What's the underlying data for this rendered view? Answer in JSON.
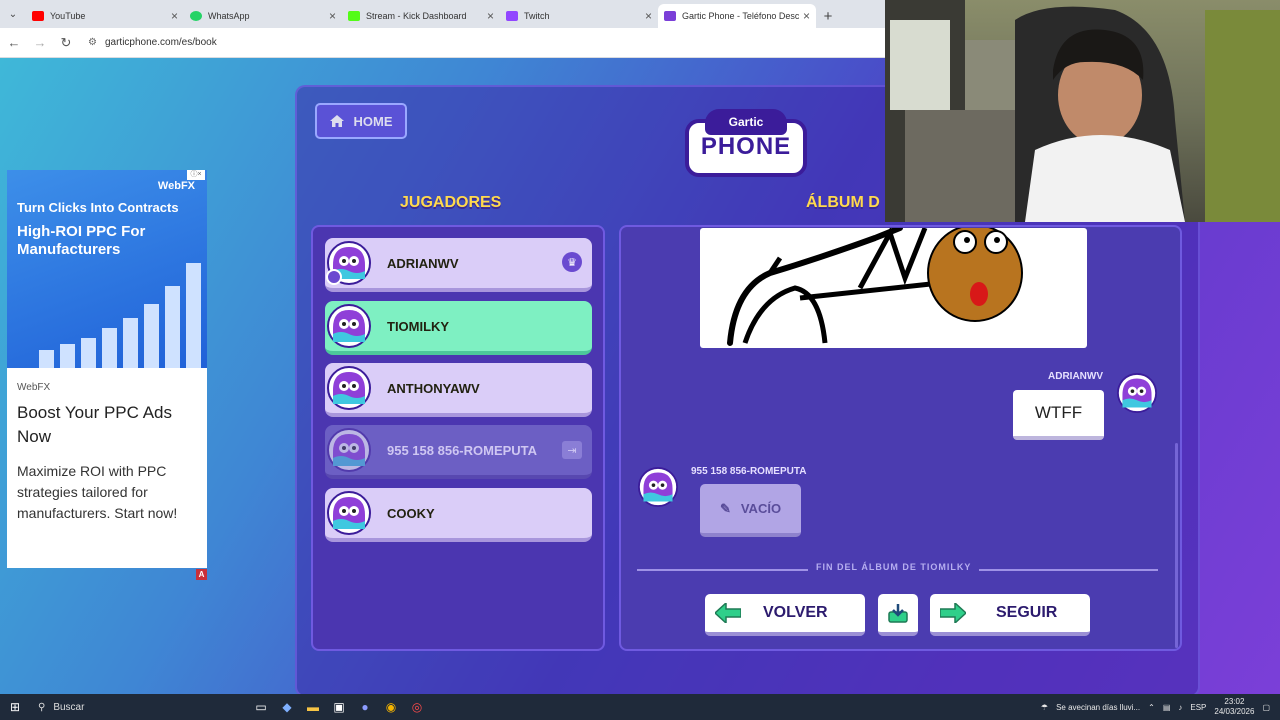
{
  "browser": {
    "tabs": [
      {
        "label": "YouTube",
        "icon": "youtube-icon",
        "color": "#ff0000",
        "active": false
      },
      {
        "label": "WhatsApp",
        "icon": "whatsapp-icon",
        "color": "#25d366",
        "active": false
      },
      {
        "label": "Stream - Kick Dashboard",
        "icon": "kick-icon",
        "color": "#53fc18",
        "active": false
      },
      {
        "label": "Twitch",
        "icon": "twitch-icon",
        "color": "#9146ff",
        "active": false
      },
      {
        "label": "Gartic Phone - Teléfono Descom",
        "icon": "gartic-icon",
        "color": "#7b3fd8",
        "active": true
      }
    ],
    "url": "garticphone.com/es/book"
  },
  "ad": {
    "brand_top": "WebFX",
    "headline": "Turn Clicks Into Contracts",
    "subheadline": "High-ROI PPC For Manufacturers",
    "brand": "WebFX",
    "title": "Boost Your PPC Ads Now",
    "description": "Maximize ROI with PPC strategies tailored for manufacturers. Start now!",
    "badge": "A"
  },
  "game": {
    "home_label": "HOME",
    "logo_top": "Gartic",
    "logo_text": "PHONE",
    "players_title": "JUGADORES",
    "album_title": "ÁLBUM D",
    "players": [
      {
        "name": "ADRIANWV",
        "state": "host"
      },
      {
        "name": "TIOMILKY",
        "state": "selected"
      },
      {
        "name": "ANTHONYAWV",
        "state": "normal"
      },
      {
        "name": "955 158 856-ROMEPUTA",
        "state": "disconnected"
      },
      {
        "name": "COOKY",
        "state": "normal"
      }
    ],
    "album": {
      "msg1_author": "ADRIANWV",
      "msg1_text": "WTFF",
      "msg2_author": "955 158 856-ROMEPUTA",
      "msg2_text": "VACÍO",
      "end_label": "FIN DEL ÁLBUM DE TIOMILKY"
    },
    "buttons": {
      "back": "VOLVER",
      "next": "SEGUIR"
    }
  },
  "taskbar": {
    "search_placeholder": "Buscar",
    "weather": "Se avecinan días lluvi...",
    "lang": "ESP",
    "time": "23:02",
    "date": "24/03/2026"
  }
}
